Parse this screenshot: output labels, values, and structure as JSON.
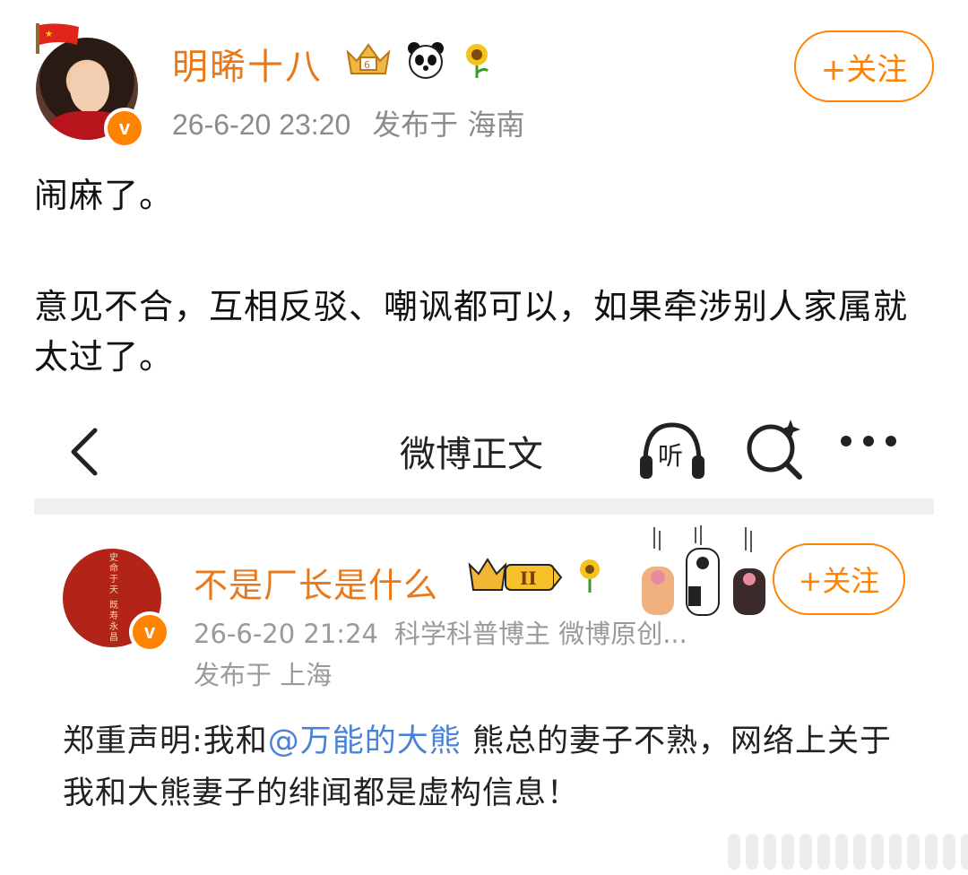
{
  "post": {
    "author": {
      "name": "明晞十八",
      "verified_badge": "v",
      "icons": [
        "flag-icon",
        "crown-level-icon",
        "panda-icon",
        "sunflower-icon"
      ]
    },
    "timestamp": "26-6-20 23:20",
    "location": "发布于 海南",
    "follow_label": "+关注",
    "content_line1": "闹麻了。",
    "content_paragraph2": "意见不合，互相反驳、嘲讽都可以，如果牵涉别人家属就太过了。"
  },
  "embedded": {
    "nav": {
      "title": "微博正文",
      "back_icon": "back-chevron-icon",
      "listen_icon": "headphones-icon",
      "listen_label": "听",
      "search_icon": "search-sparkle-icon",
      "more_icon": "more-dots-icon"
    },
    "author": {
      "name": "不是厂长是什么",
      "avatar_text": "史命于天 既寿永昌",
      "level_label": "II",
      "verified_badge": "v",
      "icons": [
        "crown-level-icon",
        "sunflower-icon",
        "cat-paws-icon"
      ]
    },
    "follow_label": "+关注",
    "timestamp": "26-6-20 21:24",
    "tags": "科学科普博主 微博原创...",
    "location": "发布于 上海",
    "content_prefix": "郑重声明:我和",
    "mention": "@万能的大熊",
    "content_suffix": " 熊总的妻子不熟，网络上关于我和大熊妻子的绯闻都是虚构信息！"
  },
  "colors": {
    "accent_orange": "#ff8200",
    "username_orange": "#e8791b",
    "meta_gray": "#8b8b8b",
    "mention_blue": "#4a82d8",
    "divider_gray": "#f0f0f0"
  }
}
